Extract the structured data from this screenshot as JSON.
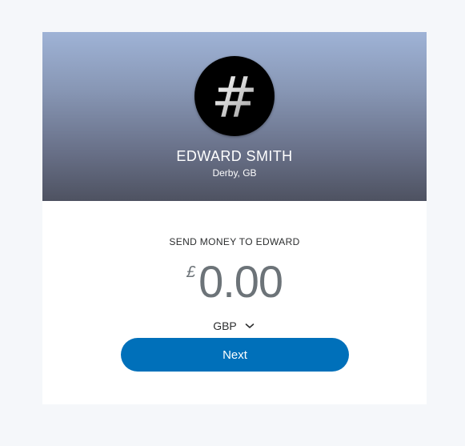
{
  "recipient": {
    "avatar_icon": "hashtag-icon",
    "avatar_glyph": "#",
    "name": "EDWARD SMITH",
    "location": "Derby, GB"
  },
  "payment": {
    "title": "SEND MONEY TO EDWARD",
    "currency_symbol": "£",
    "amount": "0.00",
    "currency_code": "GBP",
    "currency_dropdown_icon": "chevron-down-icon"
  },
  "actions": {
    "next_label": "Next"
  },
  "colors": {
    "page_background": "#f5f7fa",
    "card_background": "#ffffff",
    "hero_top": "#9fb3d6",
    "hero_bottom": "#4e5261",
    "amount_text": "#6c7378",
    "primary_button": "#0070ba"
  }
}
